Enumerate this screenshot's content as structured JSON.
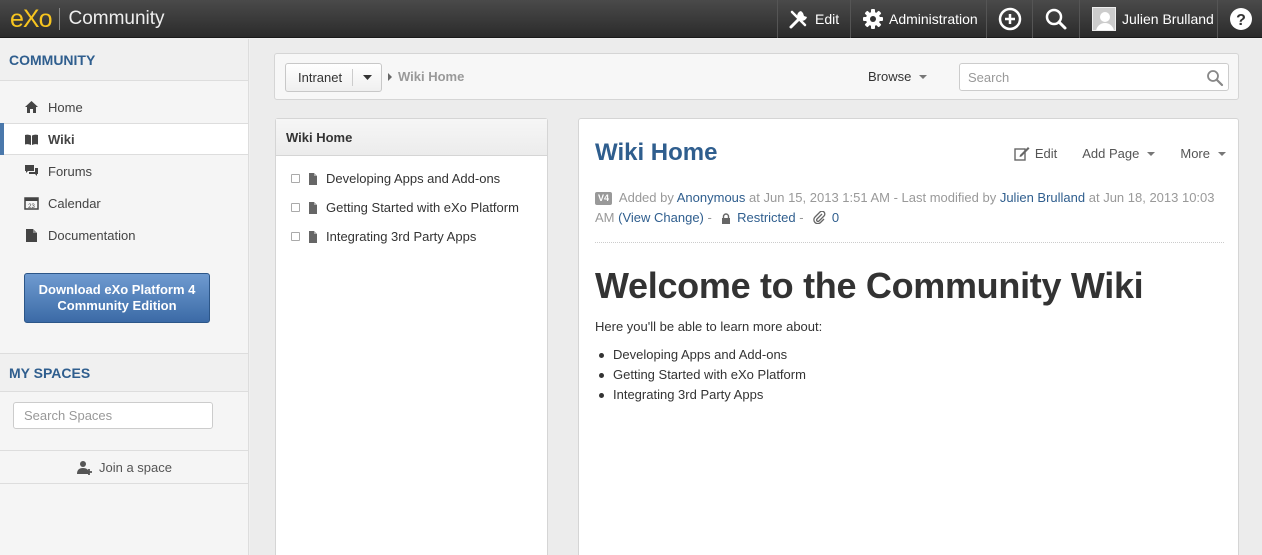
{
  "topbar": {
    "logo": "eXo",
    "brand": "Community",
    "edit_label": "Edit",
    "admin_label": "Administration",
    "user_name": "Julien Brulland"
  },
  "sidebar": {
    "title": "COMMUNITY",
    "items": [
      {
        "label": "Home",
        "icon": "home-icon"
      },
      {
        "label": "Wiki",
        "icon": "book-icon",
        "active": true
      },
      {
        "label": "Forums",
        "icon": "chat-icon"
      },
      {
        "label": "Calendar",
        "icon": "calendar-icon"
      },
      {
        "label": "Documentation",
        "icon": "document-icon"
      }
    ],
    "download_button": "Download eXo Platform 4 Community Edition",
    "my_spaces_title": "MY SPACES",
    "search_spaces_placeholder": "Search Spaces",
    "join_space_label": "Join a space"
  },
  "toolbar": {
    "space_selector": "Intranet",
    "breadcrumb": "Wiki Home",
    "browse_label": "Browse",
    "search_placeholder": "Search"
  },
  "tree": {
    "title": "Wiki Home",
    "items": [
      "Developing Apps and Add-ons",
      "Getting Started with eXo Platform",
      "Integrating 3rd Party Apps"
    ]
  },
  "page": {
    "title": "Wiki Home",
    "actions": {
      "edit": "Edit",
      "add_page": "Add Page",
      "more": "More"
    },
    "meta": {
      "version": "V4",
      "added_by_prefix": "Added by",
      "added_by": "Anonymous",
      "added_at": "at Jun 15, 2013 1:51 AM - Last modified by",
      "modified_by": "Julien Brulland",
      "modified_at": "at Jun 18, 2013 10:03 AM",
      "view_change": "(View Change)",
      "dash": "-",
      "restricted": "Restricted",
      "attachments": "0"
    },
    "heading": "Welcome to the Community Wiki",
    "intro": "Here you'll be able to learn more about:",
    "bullets": [
      "Developing Apps and Add-ons",
      "Getting Started with eXo Platform",
      "Integrating 3rd Party Apps"
    ]
  },
  "colors": {
    "accent": "#2f5e8e",
    "logo": "#f7c51f",
    "topbar": "#333333"
  }
}
